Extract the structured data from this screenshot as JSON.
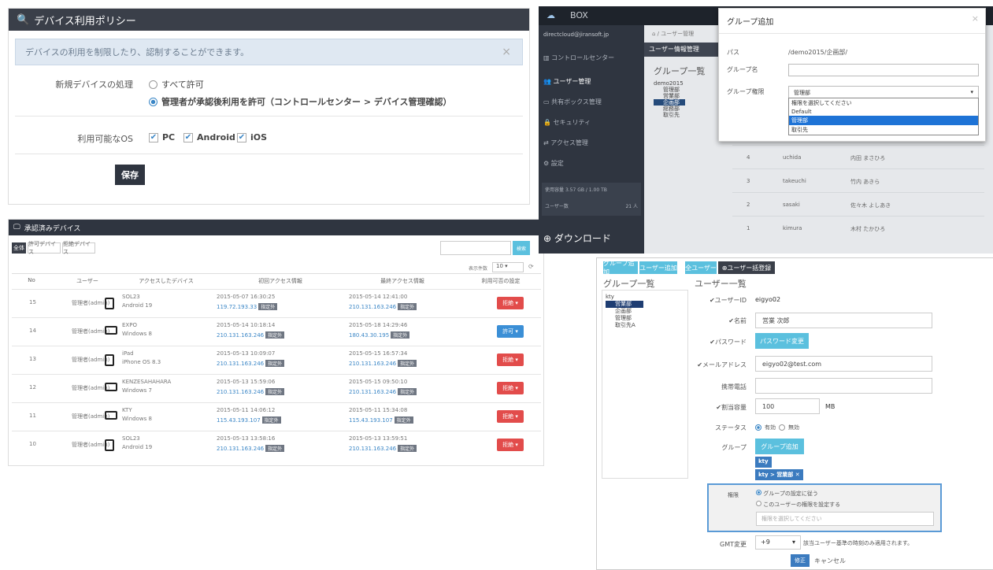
{
  "policy": {
    "title": "デバイス利用ポリシー",
    "info": "デバイスの利用を制限したり、認制することができます。",
    "new_device_label": "新規デバイスの処理",
    "opt_all": "すべて許可",
    "opt_admin": "管理者が承認後利用を許可（コントロールセンター > デバイス管理確認）",
    "os_label": "利用可能なOS",
    "os": [
      "PC",
      "Android",
      "iOS"
    ],
    "save": "保存"
  },
  "devices": {
    "title": "承認済みデバイス",
    "tabs": [
      "全体",
      "許可デバイス",
      "拒絶デバイス"
    ],
    "search_btn": "検索",
    "per_page_label": "表示件数",
    "per_page": "10",
    "headers": [
      "No",
      "ユーザー",
      "アクセスしたデバイス",
      "初回アクセス情報",
      "最終アクセス情報",
      "利用可否の設定"
    ],
    "rows": [
      {
        "no": "15",
        "user": "管理者(admin)",
        "device": "SOL23",
        "os": "Android 19",
        "first": "2015-05-07 16:30:25",
        "first_ip": "119.72.193.33",
        "last": "2015-05-14 12:41:00",
        "last_ip": "210.131.163.246",
        "status": "拒絶",
        "type": "phone"
      },
      {
        "no": "14",
        "user": "管理者(admin)",
        "device": "EXPO",
        "os": "Windows 8",
        "first": "2015-05-14 10:18:14",
        "first_ip": "210.131.163.246",
        "last": "2015-05-18 14:29:46",
        "last_ip": "180.43.30.195",
        "status": "許可",
        "type": "pc"
      },
      {
        "no": "13",
        "user": "管理者(admin)",
        "device": "iPad",
        "os": "iPhone OS 8.3",
        "first": "2015-05-13 10:09:07",
        "first_ip": "210.131.163.246",
        "last": "2015-05-15 16:57:34",
        "last_ip": "210.131.163.246",
        "status": "拒絶",
        "type": "phone"
      },
      {
        "no": "12",
        "user": "管理者(admin)",
        "device": "KENZESAHAHARA",
        "os": "Windows 7",
        "first": "2015-05-13 15:59:06",
        "first_ip": "210.131.163.246",
        "last": "2015-05-15 09:50:10",
        "last_ip": "210.131.163.246",
        "status": "拒絶",
        "type": "pc"
      },
      {
        "no": "11",
        "user": "管理者(admin)",
        "device": "KTY",
        "os": "Windows 8",
        "first": "2015-05-11 14:06:12",
        "first_ip": "115.43.193.107",
        "last": "2015-05-11 15:34:08",
        "last_ip": "115.43.193.107",
        "status": "拒絶",
        "type": "pc"
      },
      {
        "no": "10",
        "user": "管理者(admin)",
        "device": "SOL23",
        "os": "Android 19",
        "first": "2015-05-13 13:58:16",
        "first_ip": "210.131.163.246",
        "last": "2015-05-13 13:59:51",
        "last_ip": "210.131.163.246",
        "status": "拒絶",
        "type": "phone"
      }
    ],
    "ip_tag": "指定外"
  },
  "group_dialog": {
    "brand": "BOX",
    "account": "directcloud@jiransoft.jp",
    "crumb": "/ ユーザー管理",
    "side_items": [
      "コントロールセンター",
      "ユーザー管理",
      "共有ボックス管理",
      "セキュリティ",
      "アクセス管理",
      "設定"
    ],
    "usage_label": "使用容量",
    "usage": "3.57 GB / 1.00 TB",
    "user_count_label": "ユーザー数",
    "user_count": "21 人",
    "download": "ダウンロード",
    "panel_title": "ユーザー情報管理",
    "group_list": "グループ一覧",
    "tree": [
      "demo2015",
      "管理部",
      "営業部",
      "企画部",
      "総務部",
      "取引先"
    ],
    "bg_rows": [
      {
        "n": "4",
        "id": "uchida",
        "name": "内田 まさひろ"
      },
      {
        "n": "3",
        "id": "takeuchi",
        "name": "竹内 あきら"
      },
      {
        "n": "2",
        "id": "sasaki",
        "name": "佐々木 よしあき"
      },
      {
        "n": "1",
        "id": "kimura",
        "name": "木村 たかひろ"
      }
    ],
    "title": "グループ追加",
    "path_label": "パス",
    "path": "/demo2015/企画部/",
    "name_label": "グループ名",
    "auth_label": "グループ権限",
    "auth_value": "管理部",
    "options": [
      "権限を選択してください",
      "Default",
      "管理部",
      "取引先"
    ]
  },
  "user_edit": {
    "buttons": [
      "グループ追加",
      "ユーザー追加",
      "全ユーザー",
      "ユーザー括登録"
    ],
    "group_list": "グループ一覧",
    "user_list": "ユーザー一覧",
    "tree": [
      "kty",
      "営業部",
      "企画部",
      "管理部",
      "取引先A"
    ],
    "uid_label": "✔ユーザーID",
    "uid": "eigyo02",
    "name_label": "✔名前",
    "name": "営業 次郎",
    "pw_label": "✔パスワード",
    "pw_btn": "パスワード変更",
    "mail_label": "✔メールアドレス",
    "mail": "eigyo02@test.com",
    "phone_label": "携帯電話",
    "quota_label": "✔割当容量",
    "quota": "100",
    "quota_unit": "MB",
    "status_label": "ステータス",
    "status_on": "有効",
    "status_off": "無効",
    "group_label": "グループ",
    "group_btn": "グループ追加",
    "chip1": "kty",
    "chip2": "kty > 営業部",
    "auth_label": "権限",
    "auth_opt1": "グループの設定に従う",
    "auth_opt2": "このユーザーの権限を設定する",
    "auth_placeholder": "権限を選択してください",
    "gmt_label": "GMT変更",
    "gmt": "+9",
    "gmt_note": "該当ユーザー基準の時刻のみ適用されます。",
    "ok": "修正",
    "cancel": "キャンセル"
  }
}
